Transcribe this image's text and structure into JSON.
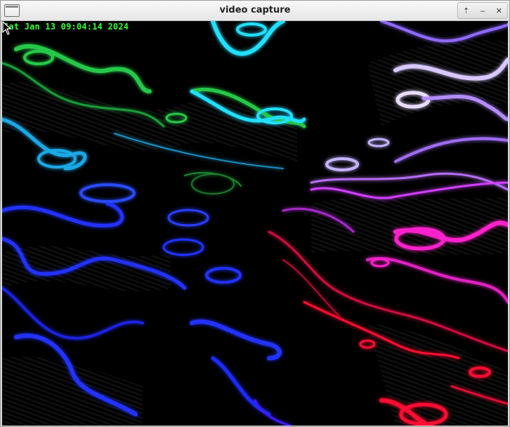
{
  "window": {
    "title": "video capture"
  },
  "titlebar_controls": {
    "shade_icon": "⇡",
    "minimize_icon": "‒",
    "close_icon": "✕"
  },
  "video": {
    "timestamp": "Sat Jan 13 09:04:14 2024",
    "timestamp_color": "#33ff33"
  },
  "colors": {
    "background": "#000000",
    "cyan": "#22e0ff",
    "green": "#25c84a",
    "blue": "#2233ff",
    "violet": "#b48cff",
    "magenta": "#ff22cc",
    "red": "#ff1133"
  }
}
